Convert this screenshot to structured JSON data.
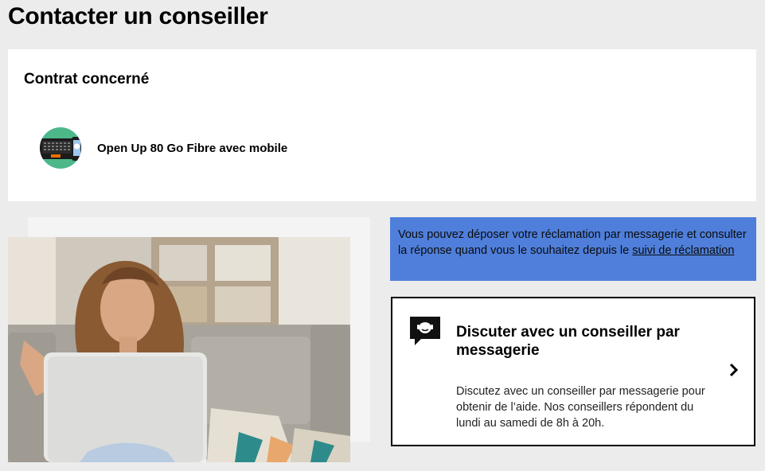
{
  "page": {
    "title": "Contacter un conseiller"
  },
  "contract": {
    "heading": "Contrat concerné",
    "name": "Open Up 80 Go Fibre avec mobile",
    "icon": "laptop-phone-icon"
  },
  "info": {
    "text": "Vous pouvez déposer votre réclamation par messagerie et consulter la réponse quand vous le souhaitez depuis le ",
    "link_label": "suivi de réclamation"
  },
  "chat": {
    "icon": "chat-advisor-icon",
    "title": "Discuter avec un conseiller par messagerie",
    "description": "Discutez avec un conseiller par messagerie pour obtenir de l’aide. Nos conseillers répondent du lundi au samedi de 8h à 20h.",
    "arrow_icon": "chevron-right-icon"
  },
  "colors": {
    "background": "#ececec",
    "info_box": "#4f7fdb",
    "contract_icon": "#4cb88a",
    "accent_orange": "#f16e00"
  }
}
